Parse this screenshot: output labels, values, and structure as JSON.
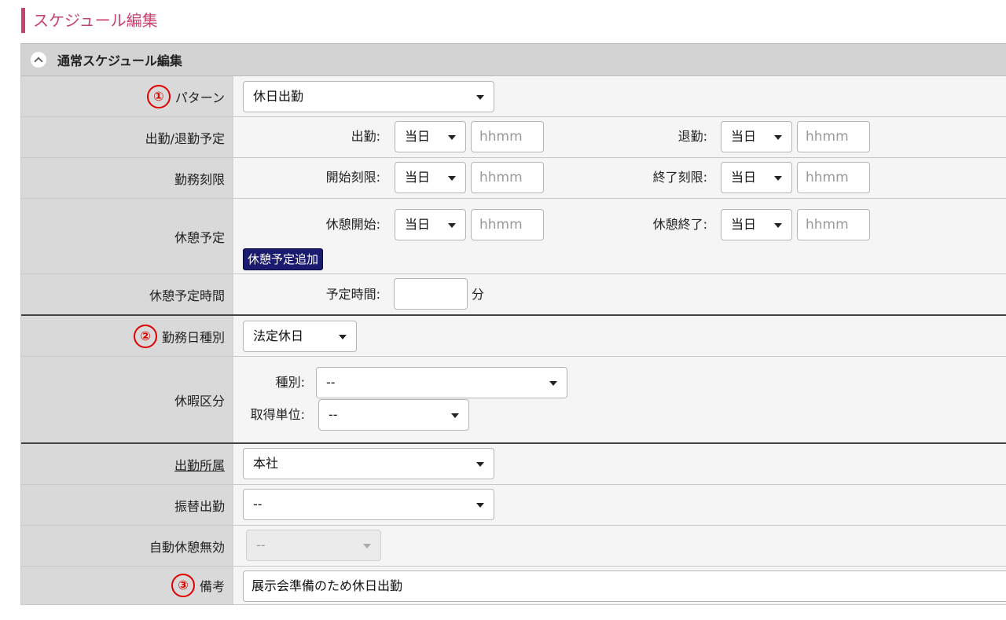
{
  "page": {
    "title": "スケジュール編集"
  },
  "panel": {
    "title": "通常スケジュール編集"
  },
  "rows": {
    "pattern": {
      "label": "パターン",
      "marker": "①",
      "value": "休日出勤"
    },
    "shift": {
      "label": "出勤/退勤予定",
      "start_label": "出勤:",
      "start_day": "当日",
      "start_time_placeholder": "hhmm",
      "end_label": "退勤:",
      "end_day": "当日",
      "end_time_placeholder": "hhmm"
    },
    "work_limit": {
      "label": "勤務刻限",
      "start_label": "開始刻限:",
      "start_day": "当日",
      "start_time_placeholder": "hhmm",
      "end_label": "終了刻限:",
      "end_day": "当日",
      "end_time_placeholder": "hhmm"
    },
    "break_plan": {
      "label": "休憩予定",
      "start_label": "休憩開始:",
      "start_day": "当日",
      "start_time_placeholder": "hhmm",
      "end_label": "休憩終了:",
      "end_day": "当日",
      "end_time_placeholder": "hhmm",
      "add_button": "休憩予定追加"
    },
    "break_time": {
      "label": "休憩予定時間",
      "field_label": "予定時間:",
      "value": "",
      "unit": "分"
    },
    "day_type": {
      "label": "勤務日種別",
      "marker": "②",
      "value": "法定休日"
    },
    "leave": {
      "label": "休暇区分",
      "type_label": "種別:",
      "type_value": "--",
      "unit_label": "取得単位:",
      "unit_value": "--"
    },
    "office": {
      "label": "出勤所属",
      "value": "本社"
    },
    "substitute": {
      "label": "振替出勤",
      "value": "--"
    },
    "auto_break": {
      "label": "自動休憩無効",
      "value": "--"
    },
    "note": {
      "label": "備考",
      "marker": "③",
      "value": "展示会準備のため休日出勤"
    }
  },
  "colors": {
    "accent": "#c8426f",
    "marker": "#e00000",
    "button": "#1a1a6e"
  }
}
